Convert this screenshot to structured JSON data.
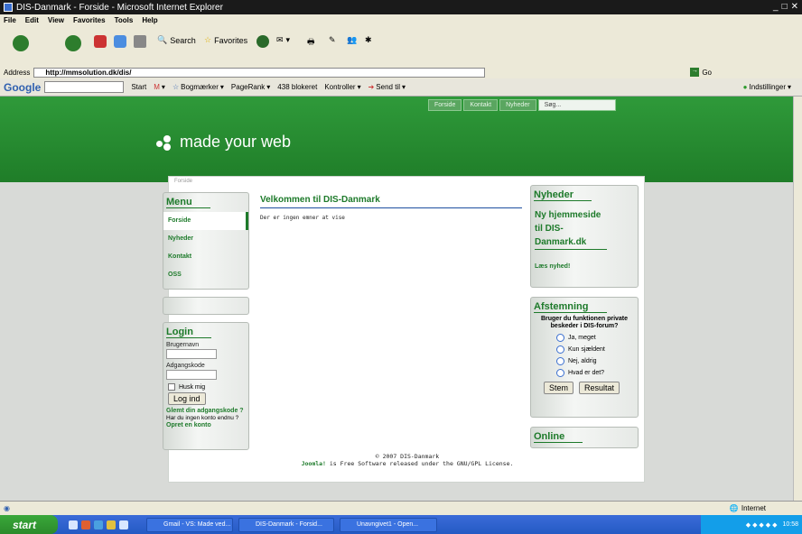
{
  "window": {
    "title": "DIS-Danmark - Forside - Microsoft Internet Explorer"
  },
  "menubar": [
    "File",
    "Edit",
    "View",
    "Favorites",
    "Tools",
    "Help"
  ],
  "toolbar": {
    "search_label": "Search",
    "favorites_label": "Favorites"
  },
  "address": {
    "label": "Address",
    "url": "http://mmsolution.dk/dis/",
    "go_label": "Go"
  },
  "googlebar": {
    "logo": "Google",
    "items": [
      "Start",
      "Bogmærker",
      "PageRank",
      "438 blokeret",
      "Kontroller",
      "Send til"
    ],
    "settings": "Indstillinger"
  },
  "site": {
    "topnav": [
      "Forside",
      "Kontakt",
      "Nyheder"
    ],
    "search_placeholder": "Søg...",
    "logo_text": "made your web",
    "tab": "Forside",
    "menu": {
      "title": "Menu",
      "items": [
        "Forside",
        "Nyheder",
        "Kontakt",
        "OSS"
      ]
    },
    "login": {
      "title": "Login",
      "username_label": "Brugernavn",
      "password_label": "Adgangskode",
      "remember_label": "Husk mig",
      "button": "Log ind",
      "forgot": "Glemt din adgangskode ?",
      "no_account": "Har du ingen konto endnu ?",
      "create": "Opret en konto"
    },
    "main": {
      "title": "Velkommen til DIS-Danmark",
      "text": "Der er ingen emner at vise"
    },
    "news": {
      "title": "Nyheder",
      "headline": "Ny hjemmeside til DIS-Danmark.dk",
      "read_more": "Læs nyhed!"
    },
    "poll": {
      "title": "Afstemning",
      "question": "Bruger du funktionen private beskeder i DIS-forum?",
      "options": [
        "Ja, meget",
        "Kun sjældent",
        "Nej, aldrig",
        "Hvad er det?"
      ],
      "vote": "Stem",
      "results": "Resultat"
    },
    "online": {
      "title": "Online"
    },
    "footer": {
      "copyright": "© 2007 DIS-Danmark",
      "joomla": "Joomla!",
      "license": " is Free Software released under the GNU/GPL License."
    }
  },
  "status": {
    "zone": "Internet"
  },
  "taskbar": {
    "start": "start",
    "tasks": [
      "Gmail - VS: Made ved...",
      "DIS-Danmark - Forsid...",
      "Unavngivet1 - Open..."
    ],
    "clock": "10:58"
  },
  "colors": {
    "green": "#1d7a2a",
    "header_green": "#2f9a3a",
    "taskbar_blue": "#245ac4"
  }
}
